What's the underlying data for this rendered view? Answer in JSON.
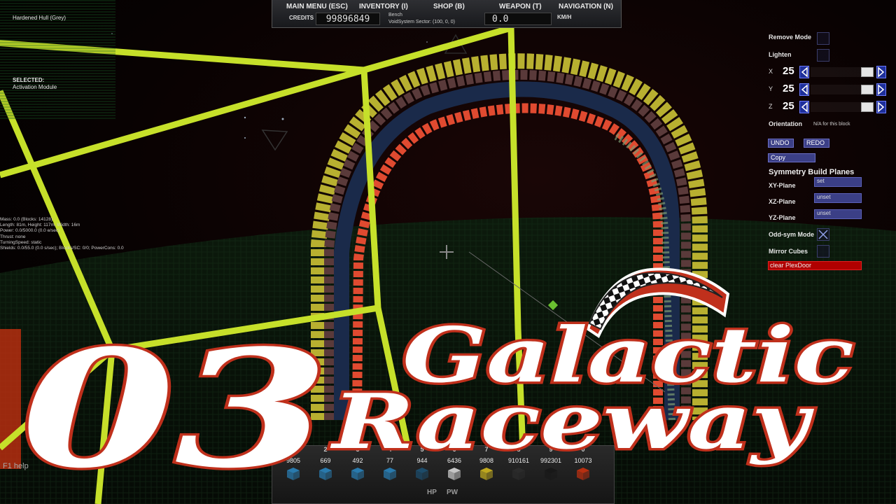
{
  "menu": {
    "main_menu": "MAIN MENU (ESC)",
    "inventory": "INVENTORY (I)",
    "shop": "SHOP (B)",
    "weapon": "WEAPON (T)",
    "navigation": "NAVIGATION (N)"
  },
  "status": {
    "credits_label": "CREDITS",
    "credits_value": "99896849",
    "location_name": "Bench",
    "sector": "VoidSystem Sector: (100, 0, 0)",
    "speed_value": "0.0",
    "speed_unit": "KM/H"
  },
  "info": {
    "hull_name": "Hardened Hull (Grey)",
    "selected_label": "SELECTED:",
    "selected_value": "Activation Module",
    "stats": [
      "Mass: 0.0 (Blocks: 14128)",
      "Length: 81m, Height: 117m, Width: 16m",
      "Power: 0.0/5000.0 (0.0 e/sec)",
      "Thrust: none",
      "TurningSpeed: static",
      "Shields: 0.0/55.0 (0.0 s/sec); Blocks/SC: 0/0; PowerCons: 0.0"
    ],
    "help": "F1 help"
  },
  "build": {
    "remove_mode": "Remove Mode",
    "lighten": "Lighten",
    "axes": [
      {
        "label": "X",
        "value": "25"
      },
      {
        "label": "Y",
        "value": "25"
      },
      {
        "label": "Z",
        "value": "25"
      }
    ],
    "orientation_label": "Orientation",
    "orientation_value": "N/A for this block",
    "undo": "UNDO",
    "redo": "REDO",
    "copy": "Copy",
    "symmetry_title": "Symmetry Build Planes",
    "xy_plane": "XY-Plane",
    "xy_value": "set",
    "xz_plane": "XZ-Plane",
    "xz_value": "unset",
    "yz_plane": "YZ-Plane",
    "yz_value": "unset",
    "odd_sym": "Odd-sym Mode",
    "odd_sym_checked": true,
    "mirror_cubes": "Mirror Cubes",
    "clear_plexdoor": "clear PlexDoor"
  },
  "hotbar": {
    "slots": [
      {
        "num": "1",
        "count": "9805",
        "color": "#2a7fb5"
      },
      {
        "num": "2",
        "count": "669",
        "color": "#2a7fb5"
      },
      {
        "num": "3",
        "count": "492",
        "color": "#2a7fb5"
      },
      {
        "num": "4",
        "count": "77",
        "color": "#2a7fb5"
      },
      {
        "num": "5",
        "count": "944",
        "color": "#1d4f6f"
      },
      {
        "num": "6",
        "count": "6436",
        "color": "#d0d0d0"
      },
      {
        "num": "7",
        "count": "9808",
        "color": "#c8b020"
      },
      {
        "num": "8",
        "count": "910161",
        "color": "#2c2c2c"
      },
      {
        "num": "9",
        "count": "992301",
        "color": "#181818"
      },
      {
        "num": "0",
        "count": "10073",
        "color": "#c03010"
      }
    ],
    "hp": "HP",
    "pw": "PW"
  },
  "title": {
    "episode": "03",
    "line1": "Galactic",
    "line2": "Raceway"
  },
  "colors": {
    "wireframe": "#c6e02a",
    "track_red": "#e04a30",
    "track_yellow": "#c8c030",
    "accent_blue": "#3b3f86",
    "title_outline": "#c0301c"
  }
}
